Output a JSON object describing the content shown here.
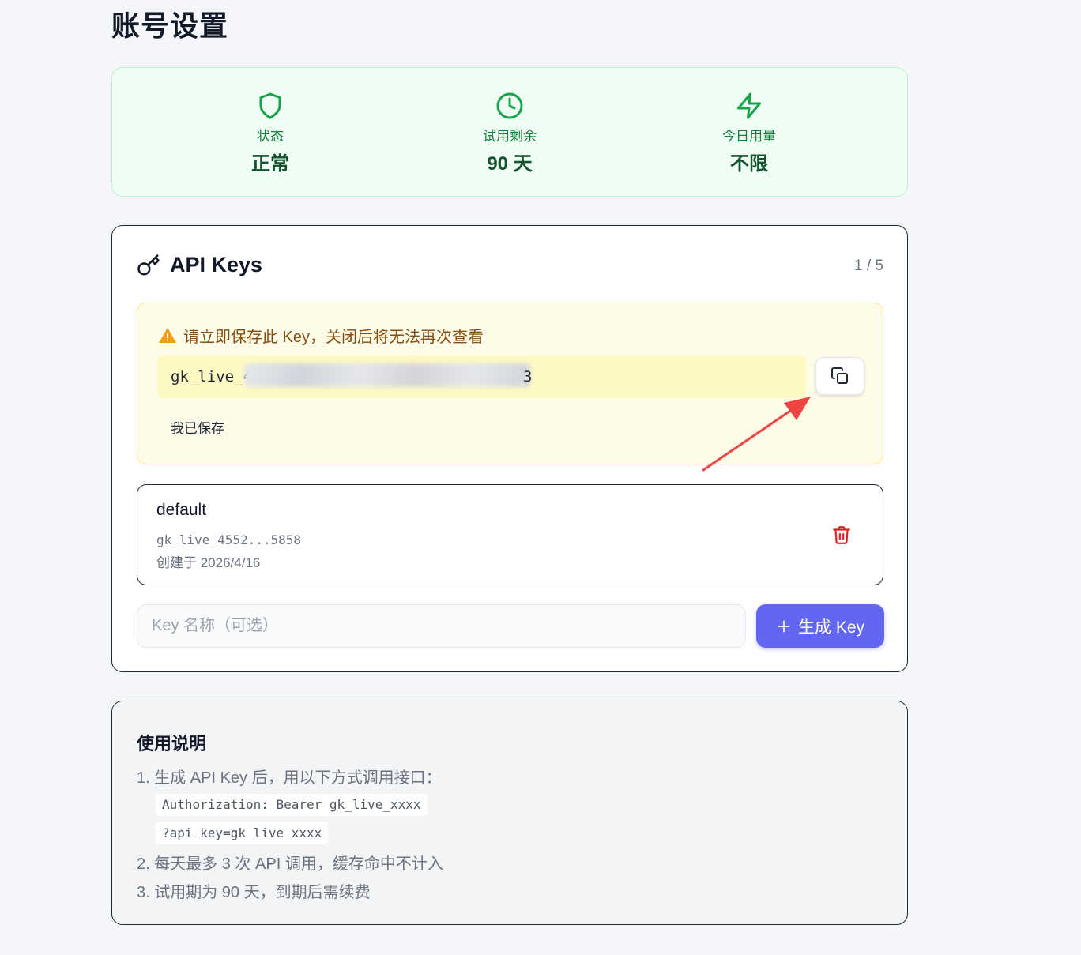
{
  "page": {
    "title": "账号设置"
  },
  "status": {
    "items": [
      {
        "label": "状态",
        "value": "正常",
        "icon": "shield-icon"
      },
      {
        "label": "试用剩余",
        "value": "90 天",
        "icon": "clock-icon"
      },
      {
        "label": "今日用量",
        "value": "不限",
        "icon": "lightning-icon"
      }
    ],
    "accent": "#16a34a"
  },
  "api_keys": {
    "title": "API Keys",
    "count": "1 / 5",
    "new_key": {
      "warning": "请立即保存此 Key，关闭后将无法再次查看",
      "value_visible": "gk_live_4",
      "value_tail": "3",
      "saved_label": "我已保存"
    },
    "items": [
      {
        "name": "default",
        "masked": "gk_live_4552...5858",
        "created": "创建于 2026/4/16"
      }
    ],
    "name_input_placeholder": "Key 名称（可选）",
    "generate_label": "生成 Key",
    "brand_color": "#6366f1"
  },
  "usage": {
    "title": "使用说明",
    "line1": "1. 生成 API Key 后，用以下方式调用接口：",
    "code1": "Authorization: Bearer gk_live_xxxx",
    "code2": "?api_key=gk_live_xxxx",
    "line2": "2. 每天最多 3 次 API 调用，缓存命中不计入",
    "line3": "3. 试用期为 90 天，到期后需续费"
  }
}
